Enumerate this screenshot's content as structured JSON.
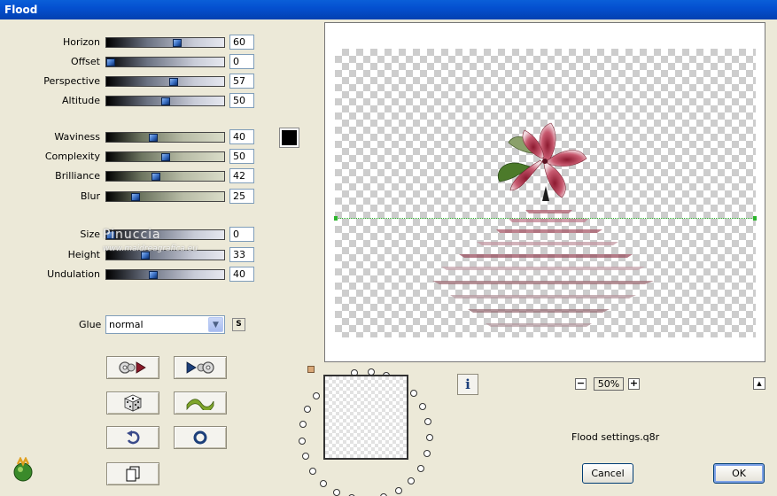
{
  "window": {
    "title": "Flood"
  },
  "params": [
    {
      "label": "Horizon",
      "value": "60",
      "level": 0.6,
      "style": "blue"
    },
    {
      "label": "Offset",
      "value": "0",
      "level": 0.0,
      "style": "blue"
    },
    {
      "label": "Perspective",
      "value": "57",
      "level": 0.57,
      "style": "blue"
    },
    {
      "label": "Altitude",
      "value": "50",
      "level": 0.5,
      "style": "blue"
    },
    {
      "label": "Waviness",
      "value": "40",
      "level": 0.4,
      "style": "wave"
    },
    {
      "label": "Complexity",
      "value": "50",
      "level": 0.5,
      "style": "wave"
    },
    {
      "label": "Brilliance",
      "value": "42",
      "level": 0.42,
      "style": "wave"
    },
    {
      "label": "Blur",
      "value": "25",
      "level": 0.25,
      "style": "wave"
    },
    {
      "label": "Size",
      "value": "0",
      "level": 0.0,
      "style": "blue"
    },
    {
      "label": "Height",
      "value": "33",
      "level": 0.33,
      "style": "blue"
    },
    {
      "label": "Undulation",
      "value": "40",
      "level": 0.4,
      "style": "blue"
    }
  ],
  "color_swatch": {
    "color": "#000000"
  },
  "watermark": {
    "name": "Pinuccia",
    "site": "www.maidreagrafica.eu"
  },
  "glue": {
    "label": "Glue",
    "value": "normal",
    "s_label": "S"
  },
  "toolbar": [
    {
      "icon": "load-preset-icon"
    },
    {
      "icon": "save-preset-icon"
    },
    {
      "icon": "randomize-dice-icon"
    },
    {
      "icon": "wave-icon"
    },
    {
      "icon": "undo-icon"
    },
    {
      "icon": "reset-icon"
    },
    {
      "icon": "copy-icon"
    }
  ],
  "preview": {
    "zoom": "50%",
    "minus": "−",
    "plus": "+",
    "info": "i"
  },
  "settings_file": "Flood settings.q8r",
  "buttons": {
    "cancel": "Cancel",
    "ok": "OK"
  }
}
